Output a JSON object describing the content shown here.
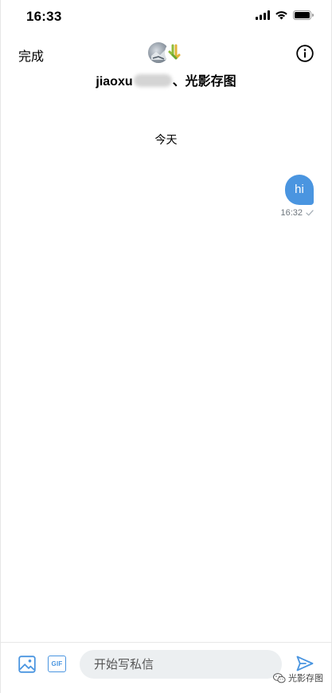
{
  "status_bar": {
    "time": "16:33",
    "icons": [
      "cellular-signal-icon",
      "wifi-icon",
      "battery-icon"
    ]
  },
  "header": {
    "done_label": "完成",
    "title_prefix": "jiaoxu",
    "title_suffix": "、光影存图",
    "info_icon": "info-circle-icon",
    "accent": "#000000"
  },
  "thread": {
    "date_divider": "今天",
    "messages": [
      {
        "text": "hi",
        "time": "16:32",
        "status_icon": "checkmark-icon",
        "outgoing": true,
        "bubble_color": "#4a95e0"
      }
    ]
  },
  "composer": {
    "placeholder": "开始写私信",
    "image_icon": "image-icon",
    "gif_label": "GIF",
    "send_icon": "send-icon",
    "accent": "#4a95e0"
  },
  "watermark": {
    "text": "光影存图",
    "icon": "wechat-icon"
  }
}
